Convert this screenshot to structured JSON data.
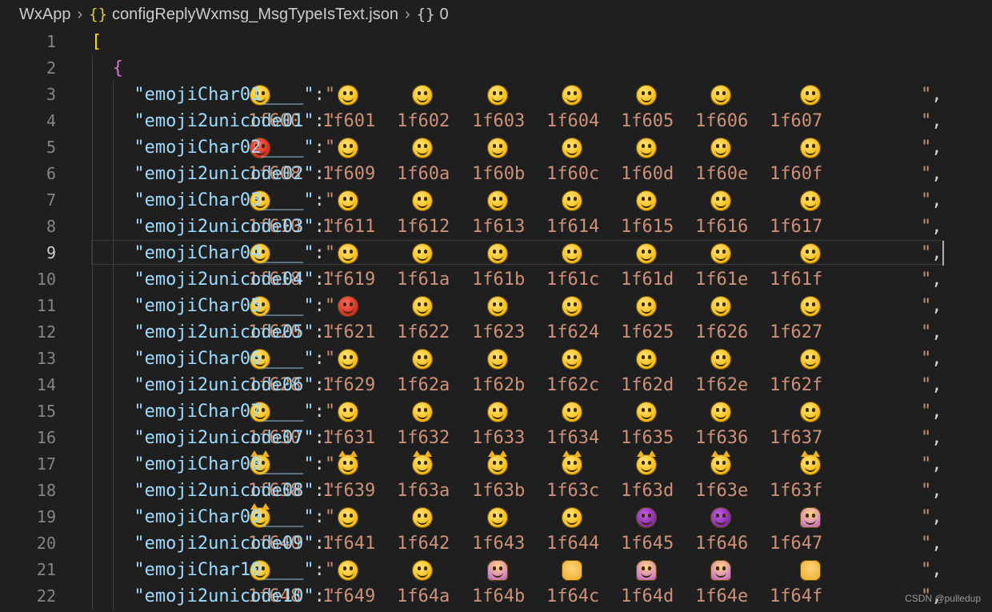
{
  "breadcrumb": {
    "root": "WxApp",
    "file_icon": "{}",
    "file": "configReplyWxmsg_MsgTypeIsText.json",
    "node_icon": "{}",
    "node": "0"
  },
  "editor": {
    "current_line": 9,
    "line1_text": "[",
    "line2_text": "{",
    "rows": [
      {
        "type": "emoji",
        "key": "\"emojiChar01____\"",
        "variants": [
          "normal",
          "normal",
          "normal",
          "normal",
          "normal",
          "normal",
          "normal",
          "normal"
        ]
      },
      {
        "type": "code",
        "key": "\"emoji2unicode01\"",
        "values": [
          "1f600",
          "1f601",
          "1f602",
          "1f603",
          "1f604",
          "1f605",
          "1f606",
          "1f607"
        ]
      },
      {
        "type": "emoji",
        "key": "\"emojiChar02____\"",
        "variants": [
          "red",
          "normal",
          "normal",
          "normal",
          "normal",
          "normal",
          "normal",
          "normal"
        ]
      },
      {
        "type": "code",
        "key": "\"emoji2unicode02\"",
        "values": [
          "1f608",
          "1f609",
          "1f60a",
          "1f60b",
          "1f60c",
          "1f60d",
          "1f60e",
          "1f60f"
        ]
      },
      {
        "type": "emoji",
        "key": "\"emojiChar03____\"",
        "variants": [
          "normal",
          "normal",
          "normal",
          "normal",
          "normal",
          "normal",
          "normal",
          "normal"
        ]
      },
      {
        "type": "code",
        "key": "\"emoji2unicode03\"",
        "values": [
          "1f610",
          "1f611",
          "1f612",
          "1f613",
          "1f614",
          "1f615",
          "1f616",
          "1f617 "
        ]
      },
      {
        "type": "emoji",
        "key": "\"emojiChar04____\"",
        "variants": [
          "normal",
          "normal",
          "normal",
          "normal",
          "normal",
          "normal",
          "normal",
          "normal"
        ]
      },
      {
        "type": "code",
        "key": "\"emoji2unicode04\"",
        "values": [
          "1f618",
          "1f619",
          "1f61a",
          "1f61b",
          "1f61c",
          "1f61d",
          "1f61e",
          "1f61f"
        ]
      },
      {
        "type": "emoji",
        "key": "\"emojiChar05____\"",
        "variants": [
          "normal",
          "red",
          "normal",
          "normal",
          "normal",
          "normal",
          "normal",
          "normal"
        ]
      },
      {
        "type": "code",
        "key": "\"emoji2unicode05\"",
        "values": [
          "1f620",
          "1f621",
          "1f622",
          "1f623",
          "1f624",
          "1f625",
          "1f626",
          "1f627"
        ]
      },
      {
        "type": "emoji",
        "key": "\"emojiChar06____\"",
        "variants": [
          "normal",
          "normal",
          "normal",
          "normal",
          "normal",
          "normal",
          "normal",
          "normal"
        ]
      },
      {
        "type": "code",
        "key": "\"emoji2unicode06\"",
        "values": [
          "1f628",
          "1f629",
          "1f62a",
          "1f62b",
          "1f62c",
          "1f62d",
          "1f62e",
          "1f62f"
        ]
      },
      {
        "type": "emoji",
        "key": "\"emojiChar07____\"",
        "variants": [
          "normal",
          "normal",
          "normal",
          "normal",
          "normal",
          "normal",
          "normal",
          "normal"
        ]
      },
      {
        "type": "code",
        "key": "\"emoji2unicode07\"",
        "values": [
          "1f630",
          "1f631",
          "1f632",
          "1f633",
          "1f634",
          "1f635",
          "1f636",
          "1f637"
        ]
      },
      {
        "type": "emoji",
        "key": "\"emojiChar08____\"",
        "variants": [
          "cat",
          "cat",
          "cat",
          "cat",
          "cat",
          "cat",
          "cat",
          "cat"
        ]
      },
      {
        "type": "code",
        "key": "\"emoji2unicode08\"",
        "values": [
          "1f638",
          "1f639",
          "1f63a",
          "1f63b",
          "1f63c",
          "1f63d",
          "1f63e",
          "1f63f"
        ]
      },
      {
        "type": "emoji",
        "key": "\"emojiChar09____\"",
        "variants": [
          "cat",
          "normal",
          "normal",
          "normal",
          "normal",
          "purple",
          "purple",
          "person"
        ]
      },
      {
        "type": "code",
        "key": "\"emoji2unicode09\"",
        "values": [
          "1f640",
          "1f641",
          "1f642",
          "1f643",
          "1f644",
          "1f645",
          "1f646",
          "1f647"
        ]
      },
      {
        "type": "emoji",
        "key": "\"emojiChar10____\"",
        "variants": [
          "normal",
          "normal",
          "normal",
          "person",
          "hands",
          "person",
          "person",
          "hands"
        ]
      },
      {
        "type": "code",
        "key": "\"emoji2unicode10\"",
        "values": [
          "1f648",
          "1f649",
          "1f64a",
          "1f64b",
          "1f64c",
          "1f64d",
          "1f64e",
          "1f64f"
        ]
      }
    ]
  },
  "watermark": "CSDN @pulledup"
}
